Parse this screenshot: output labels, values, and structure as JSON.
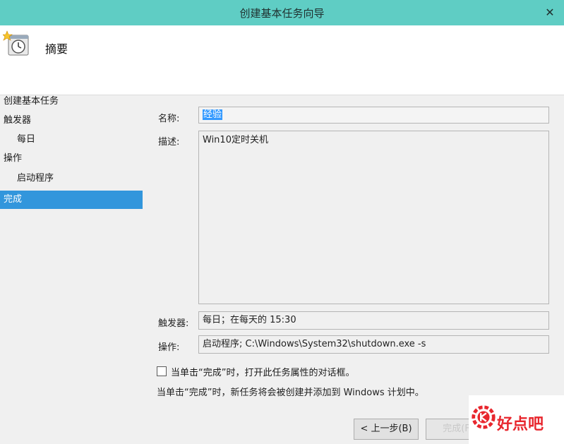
{
  "window": {
    "title": "创建基本任务向导",
    "close_glyph": "✕"
  },
  "header": {
    "heading": "摘要",
    "icon": "scheduled-task-clock-icon"
  },
  "sidebar": {
    "items": [
      {
        "label": "创建基本任务"
      },
      {
        "label": "触发器"
      },
      {
        "label": "每日"
      },
      {
        "label": "操作"
      },
      {
        "label": "启动程序"
      },
      {
        "label": "完成"
      }
    ],
    "active_index": 5
  },
  "form": {
    "name_label": "名称:",
    "name_value": "经验",
    "desc_label": "描述:",
    "desc_value": "Win10定时关机",
    "trigger_label": "触发器:",
    "trigger_value": "每日；在每天的 15:30",
    "action_label": "操作:",
    "action_value": "启动程序; C:\\Windows\\System32\\shutdown.exe -s"
  },
  "checkbox": {
    "label": "当单击“完成”时，打开此任务属性的对话框。",
    "checked": false
  },
  "info_text": "当单击“完成”时，新任务将会被创建并添加到 Windows 计划中。",
  "buttons": {
    "back": "< 上一步(B)",
    "finish": "完成(F)"
  },
  "watermark": {
    "text": "好点吧"
  },
  "colors": {
    "titlebar": "#5fcdc4",
    "selection": "#3296dc",
    "watermark": "#e8262d"
  }
}
